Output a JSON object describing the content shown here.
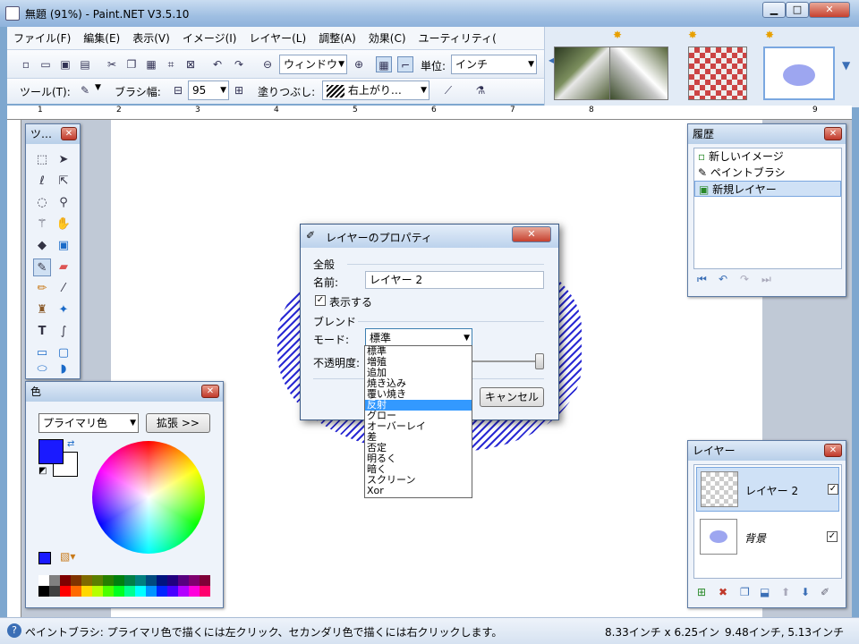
{
  "window": {
    "title": "無題 (91%) - Paint.NET V3.5.10"
  },
  "menu": [
    "ファイル(F)",
    "編集(E)",
    "表示(V)",
    "イメージ(I)",
    "レイヤー(L)",
    "調整(A)",
    "効果(C)",
    "ユーティリティ("
  ],
  "toolbar1": {
    "zoom_value": "ウィンドウ",
    "units_label": "単位:",
    "units_value": "インチ"
  },
  "toolbar2": {
    "tool_label": "ツール(T):",
    "brush_label": "ブラシ幅:",
    "brush_value": "95",
    "fill_label": "塗りつぶし:",
    "fill_value": "右上がり…"
  },
  "ruler": {
    "marks": [
      "1",
      "2",
      "3",
      "4",
      "5",
      "6",
      "7",
      "8",
      "9"
    ]
  },
  "tools_panel": {
    "title": "ツ…"
  },
  "history_panel": {
    "title": "履歴",
    "items": [
      "新しいイメージ",
      "ペイントブラシ",
      "新規レイヤー"
    ]
  },
  "colors_panel": {
    "title": "色",
    "mode": "プライマリ色",
    "expand": "拡張 >>",
    "primary": "#1a1aff",
    "secondary": "#ffffff"
  },
  "palette": [
    "#000000",
    "#404040",
    "#ff0000",
    "#ff6a00",
    "#ffd800",
    "#b6ff00",
    "#4cff00",
    "#00ff21",
    "#00ff90",
    "#00ffff",
    "#0094ff",
    "#0026ff",
    "#4800ff",
    "#b200ff",
    "#ff00dc",
    "#ff006e"
  ],
  "palette_dark": [
    "#ffffff",
    "#808080",
    "#7f0000",
    "#7f3300",
    "#7f6a00",
    "#5b7f00",
    "#267f00",
    "#007f0e",
    "#007f46",
    "#007f7f",
    "#004a7f",
    "#00137f",
    "#21007f",
    "#57007f",
    "#7f006e",
    "#7f0037"
  ],
  "layers_panel": {
    "title": "レイヤー",
    "layers": [
      {
        "name": "レイヤー 2",
        "visible": true,
        "selected": true
      },
      {
        "name": "背景",
        "visible": true,
        "selected": false
      }
    ]
  },
  "dialog": {
    "title": "レイヤーのプロパティ",
    "general": "全般",
    "name_label": "名前:",
    "name_value": "レイヤー 2",
    "visible_label": "表示する",
    "blend": "ブレンド",
    "mode_label": "モード:",
    "mode_value": "標準",
    "opacity_label": "不透明度:",
    "cancel": "キャンセル"
  },
  "blend_modes": [
    "標準",
    "増殖",
    "追加",
    "焼き込み",
    "覆い焼き",
    "反射",
    "グロー",
    "オーバーレイ",
    "差",
    "否定",
    "明るく",
    "暗く",
    "スクリーン",
    "Xor"
  ],
  "blend_selected": "反射",
  "status": {
    "hint": "ペイントブラシ: プライマリ色で描くには左クリック、セカンダリ色で描くには右クリックします。",
    "size": "8.33インチ x 6.25イン",
    "pos": "9.48インチ, 5.13インチ"
  }
}
